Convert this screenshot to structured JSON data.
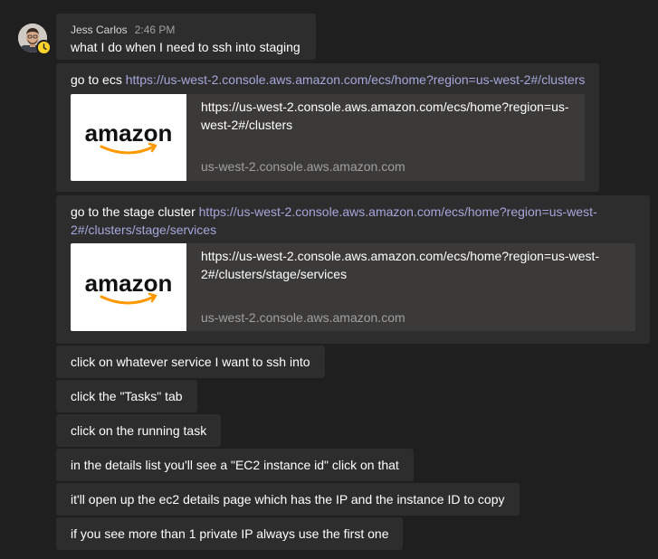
{
  "message_group": {
    "author": "Jess Carlos",
    "time": "2:46 PM",
    "avatar_icon": "user-avatar",
    "presence_icon": "away-clock-icon",
    "presence_color": "#f8d22a"
  },
  "messages": [
    {
      "text": "what I do when I need to ssh into staging"
    },
    {
      "prefix": "go to ecs ",
      "link": "https://us-west-2.console.aws.amazon.com/ecs/home?region=us-west-2#/clusters",
      "preview": {
        "title_line1": "https://us-west-2.console.aws.amazon.com/ecs/home?region=us-",
        "title_line2": "west-2#/clusters",
        "domain": "us-west-2.console.aws.amazon.com",
        "logo_text": "amazon"
      }
    },
    {
      "prefix": "go to the stage cluster ",
      "link_line1": "https://us-west-2.console.aws.amazon.com/ecs/home?region=us-west-",
      "link_line2": "2#/clusters/stage/services",
      "preview": {
        "title_line1": "https://us-west-2.console.aws.amazon.com/ecs/home?region=us-west-",
        "title_line2": "2#/clusters/stage/services",
        "domain": "us-west-2.console.aws.amazon.com",
        "logo_text": "amazon"
      }
    },
    {
      "text": "click on whatever service I want to ssh into"
    },
    {
      "text": "click the \"Tasks\" tab"
    },
    {
      "text": "click on the running task"
    },
    {
      "text": "in the details list you'll see a \"EC2 instance id\" click on that"
    },
    {
      "text": "it'll open up the ec2 details page which has the IP and the instance ID to copy"
    },
    {
      "text": "if you see more than 1 private IP always use the first one"
    }
  ],
  "colors": {
    "background": "#1f1f1f",
    "bubble": "#2d2d2d",
    "card": "#3b3a39",
    "link": "#a6a7dc",
    "amazon_smile": "#ff9900"
  }
}
